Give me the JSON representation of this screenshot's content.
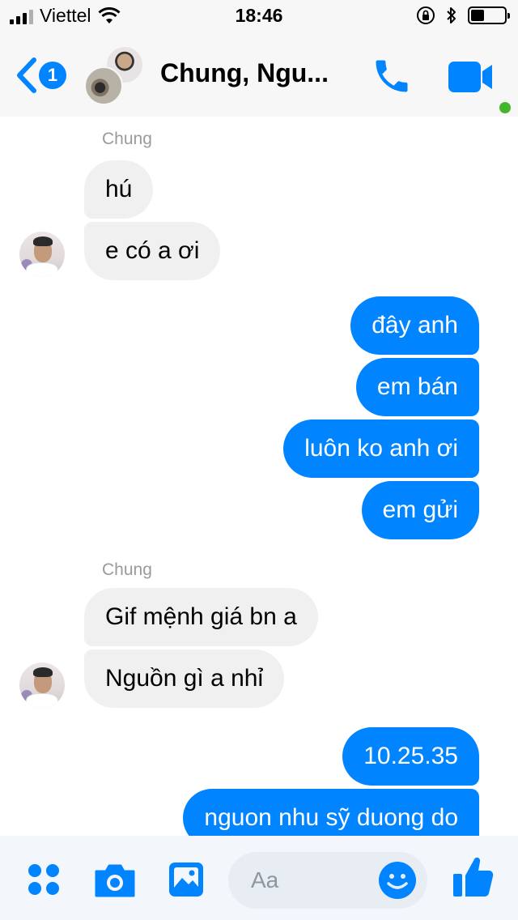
{
  "status_bar": {
    "carrier": "Viettel",
    "time": "18:46",
    "battery_level": 0.4,
    "icons": [
      "signal-icon",
      "wifi-icon",
      "orientation-lock-icon",
      "bluetooth-icon",
      "battery-icon"
    ]
  },
  "header": {
    "unread_count": "1",
    "title": "Chung, Ngu...",
    "icons": [
      "back-chevron-icon",
      "phone-icon",
      "video-camera-icon"
    ],
    "active_status_color": "#42b72a"
  },
  "messages": {
    "group1": {
      "sender": "Chung",
      "items": [
        "hú",
        "e có a ơi"
      ]
    },
    "outgoing1": [
      "đây anh",
      "em bán",
      "luôn ko anh ơi",
      "em gửi"
    ],
    "group2": {
      "sender": "Chung",
      "items": [
        "Gif mệnh giá bn a",
        "Nguồn gì a nhỉ"
      ]
    },
    "outgoing2": [
      "10.25.35",
      "nguon nhu sỹ duong do"
    ]
  },
  "composer": {
    "placeholder": "Aa",
    "icons": [
      "apps-grid-icon",
      "camera-icon",
      "photo-gallery-icon",
      "emoji-icon",
      "thumbs-up-icon"
    ]
  },
  "colors": {
    "accent": "#0084ff",
    "incoming_bubble": "#f1f0f0",
    "sender_label": "#9a9a9a"
  }
}
